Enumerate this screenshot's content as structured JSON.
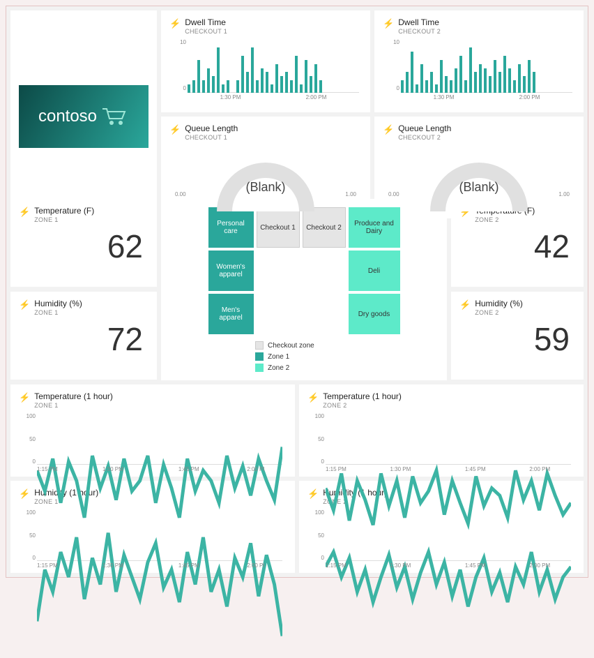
{
  "logo": {
    "text": "contoso"
  },
  "dwell": [
    {
      "title": "Dwell Time",
      "sub": "CHECKOUT 1",
      "ymax": 10,
      "y0": 0
    },
    {
      "title": "Dwell Time",
      "sub": "CHECKOUT 2",
      "ymax": 10,
      "y0": 0
    }
  ],
  "queue": [
    {
      "title": "Queue Length",
      "sub": "CHECKOUT 1",
      "value": "(Blank)",
      "min": "0.00",
      "max": "1.00"
    },
    {
      "title": "Queue Length",
      "sub": "CHECKOUT 2",
      "value": "(Blank)",
      "min": "0.00",
      "max": "1.00"
    }
  ],
  "kpi": {
    "temp1": {
      "title": "Temperature (F)",
      "sub": "ZONE 1",
      "value": "62"
    },
    "hum1": {
      "title": "Humidity (%)",
      "sub": "ZONE 1",
      "value": "72"
    },
    "temp2": {
      "title": "Temperature (F)",
      "sub": "ZONE 2",
      "value": "42"
    },
    "hum2": {
      "title": "Humidity (%)",
      "sub": "ZONE 2",
      "value": "59"
    }
  },
  "map": {
    "cells": [
      [
        "Personal care",
        "z1"
      ],
      [
        "Checkout 1",
        "zc"
      ],
      [
        "Checkout 2",
        "zc"
      ],
      [
        "Produce and Dairy",
        "z2"
      ],
      [
        "Women's apparel",
        "z1"
      ],
      [
        "",
        "zblank"
      ],
      [
        "",
        "zblank"
      ],
      [
        "Deli",
        "z2"
      ],
      [
        "Men's apparel",
        "z1"
      ],
      [
        "",
        "zblank"
      ],
      [
        "",
        "zblank"
      ],
      [
        "Dry goods",
        "z2"
      ]
    ],
    "legend": [
      {
        "sw": "c",
        "label": "Checkout zone"
      },
      {
        "sw": "a",
        "label": "Zone 1"
      },
      {
        "sw": "b",
        "label": "Zone 2"
      }
    ]
  },
  "timeTicks": [
    "1:30 PM",
    "2:00 PM"
  ],
  "hourTicks": [
    "1:15 PM",
    "1:30 PM",
    "1:45 PM",
    "2:00 PM"
  ],
  "hourTicksShort": [
    "1:15 PM",
    "1:30 PM",
    "1:45 PM",
    "2:00 PI"
  ],
  "lines": {
    "temp1": {
      "title": "Temperature (1 hour)",
      "sub": "ZONE 1"
    },
    "temp2": {
      "title": "Temperature (1 hour)",
      "sub": "ZONE 2"
    },
    "hum1": {
      "title": "Humidity (1 hour)",
      "sub": "ZONE 1"
    },
    "hum2": {
      "title": "Humidity (1 hour)",
      "sub": "ZONE 2"
    }
  },
  "lineY": {
    "top": "100",
    "mid": "50",
    "bot": "0"
  },
  "chart_data": [
    {
      "type": "bar",
      "title": "Dwell Time",
      "subtitle": "CHECKOUT 1",
      "ylim": [
        0,
        12
      ],
      "xticks": [
        "1:30 PM",
        "2:00 PM"
      ],
      "values": [
        2,
        3,
        8,
        3,
        6,
        4,
        11,
        2,
        3,
        0,
        3,
        9,
        5,
        11,
        3,
        6,
        5,
        2,
        7,
        4,
        5,
        3,
        9,
        2,
        8,
        4,
        7,
        3
      ]
    },
    {
      "type": "bar",
      "title": "Dwell Time",
      "subtitle": "CHECKOUT 2",
      "ylim": [
        0,
        12
      ],
      "xticks": [
        "1:30 PM",
        "2:00 PM"
      ],
      "values": [
        3,
        5,
        10,
        2,
        7,
        3,
        5,
        2,
        8,
        4,
        3,
        6,
        9,
        3,
        11,
        5,
        7,
        6,
        4,
        8,
        5,
        9,
        6,
        3,
        7,
        4,
        8,
        5
      ]
    },
    {
      "type": "gauge",
      "title": "Queue Length",
      "subtitle": "CHECKOUT 1",
      "range": [
        0,
        1
      ],
      "value": null,
      "display": "(Blank)"
    },
    {
      "type": "gauge",
      "title": "Queue Length",
      "subtitle": "CHECKOUT 2",
      "range": [
        0,
        1
      ],
      "value": null,
      "display": "(Blank)"
    },
    {
      "type": "line",
      "title": "Temperature (1 hour)",
      "subtitle": "ZONE 1",
      "ylim": [
        0,
        100
      ],
      "xticks": [
        "1:15 PM",
        "1:30 PM",
        "1:45 PM",
        "2:00 PM"
      ],
      "values": [
        62,
        48,
        70,
        40,
        68,
        55,
        30,
        72,
        50,
        65,
        42,
        70,
        48,
        55,
        72,
        40,
        66,
        50,
        30,
        70,
        48,
        62,
        55,
        40,
        72,
        50,
        65,
        45,
        70,
        55,
        42,
        78
      ]
    },
    {
      "type": "line",
      "title": "Temperature (1 hour)",
      "subtitle": "ZONE 2",
      "ylim": [
        0,
        100
      ],
      "xticks": [
        "1:15 PM",
        "1:30 PM",
        "1:45 PM",
        "2:00 PM"
      ],
      "values": [
        50,
        35,
        60,
        28,
        55,
        42,
        25,
        60,
        38,
        55,
        30,
        58,
        40,
        48,
        62,
        32,
        55,
        40,
        26,
        58,
        38,
        50,
        45,
        30,
        62,
        42,
        55,
        35,
        60,
        45,
        32,
        40
      ]
    },
    {
      "type": "line",
      "title": "Humidity (1 hour)",
      "subtitle": "ZONE 1",
      "ylim": [
        0,
        100
      ],
      "xticks": [
        "1:15 PM",
        "1:30 PM",
        "1:45 PM",
        "2:00 PM"
      ],
      "values": [
        25,
        60,
        45,
        72,
        55,
        82,
        40,
        68,
        50,
        85,
        45,
        70,
        55,
        40,
        65,
        78,
        48,
        60,
        38,
        72,
        50,
        82,
        45,
        60,
        35,
        68,
        55,
        78,
        42,
        70,
        50,
        15
      ]
    },
    {
      "type": "line",
      "title": "Humidity (1 hour)",
      "subtitle": "ZONE 2",
      "ylim": [
        0,
        100
      ],
      "xticks": [
        "1:15 PM",
        "1:30 PM",
        "1:45 PM",
        "2:00 PM"
      ],
      "values": [
        62,
        72,
        55,
        68,
        45,
        60,
        38,
        55,
        70,
        48,
        62,
        40,
        58,
        72,
        50,
        65,
        42,
        60,
        35,
        55,
        68,
        45,
        58,
        38,
        62,
        50,
        72,
        45,
        60,
        40,
        55,
        62
      ]
    }
  ]
}
